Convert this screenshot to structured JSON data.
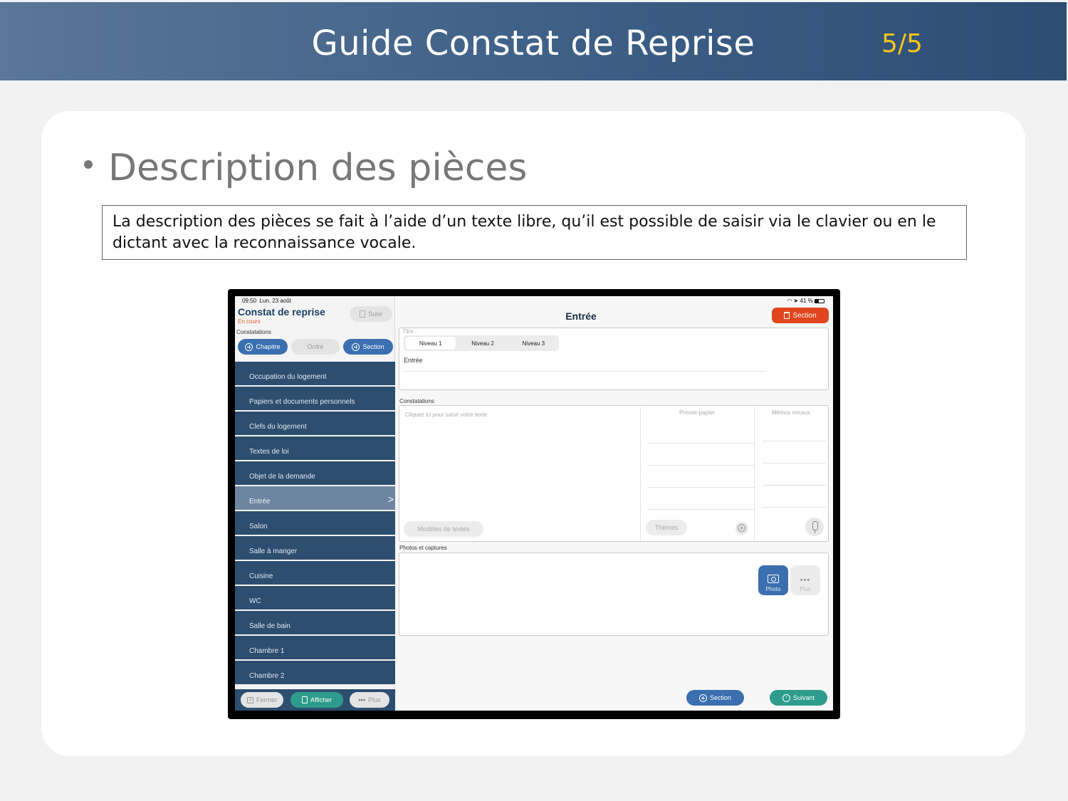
{
  "slide": {
    "title": "Guide Constat de Reprise",
    "page": "5/5",
    "heading": "Description des pièces",
    "description": "La description des pièces se fait à l’aide d’un texte libre, qu’il est possible de saisir via le clavier ou en le dictant avec la reconnaissance vocale."
  },
  "tablet": {
    "status": {
      "time": "09:50",
      "date": "Lun. 23 août",
      "battery": "41 %"
    },
    "app": {
      "title": "Constat de reprise",
      "subtitle": "En cours",
      "suivi": "Suivi",
      "constatations_label": "Constatations",
      "chapitre": "Chapitre",
      "ordre": "Ordre",
      "section": "Section"
    },
    "nav_items": [
      "Occupation du logement",
      "Papiers et documents personnels",
      "Clefs du logement",
      "Textes de loi",
      "Objet de la demande",
      "Entrée",
      "Salon",
      "Salle à manger",
      "Cuisine",
      "WC",
      "Salle de bain",
      "Chambre 1",
      "Chambre 2"
    ],
    "active_item": "Entrée",
    "bottom": {
      "fermer": "Fermer",
      "afficher": "Afficher",
      "plus": "Plus"
    },
    "main": {
      "title": "Entrée",
      "delete_section": "Section",
      "titre_label": "Titre :",
      "levels": [
        "Niveau 1",
        "Niveau 2",
        "Niveau 3"
      ],
      "titre_value": "Entrée",
      "constatations_label": "Constatations",
      "text_hint": "Cliquez ici pour saisir votre texte",
      "presse_papier": "Presse-papier",
      "memos_vocaux": "Mémos vocaux",
      "modeles": "Modèles de textes",
      "themes": "Thèmes",
      "photos_label": "Photos et captures",
      "photo": "Photo",
      "plus": "Plus",
      "add_section": "Section",
      "suivant": "Suivant"
    }
  },
  "colors": {
    "header_bar": "#3d5f86",
    "page_number": "#f5c518",
    "nav_item": "#2e4e70",
    "nav_active": "#6e85a2",
    "accent_blue": "#3b6fb0",
    "accent_red": "#e0451e",
    "accent_green": "#2e9c8c"
  }
}
